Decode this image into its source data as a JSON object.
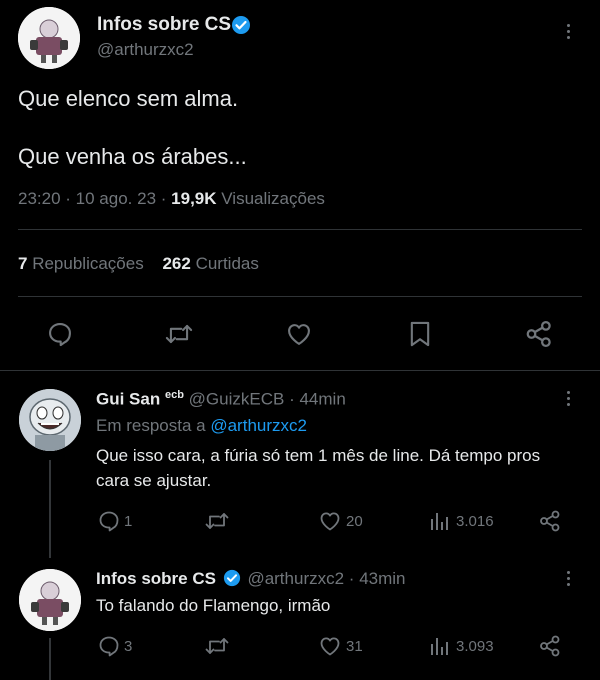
{
  "colors": {
    "background": "#000000",
    "text": "#e7e9ea",
    "muted": "#71767b",
    "accent": "#1d9bf0",
    "divider": "#2f3336"
  },
  "main_tweet": {
    "author_name": "Infos sobre CS",
    "handle": "@arthurzxc2",
    "text_line1": "Que elenco sem alma.",
    "text_line2": "Que venha os árabes...",
    "time": "23:20",
    "date": "10 ago. 23",
    "views_count": "19,9K",
    "views_label": "Visualizações",
    "reposts_count": "7",
    "reposts_label": "Republicações",
    "likes_count": "262",
    "likes_label": "Curtidas",
    "icons": [
      "reply-icon",
      "retweet-icon",
      "like-icon",
      "bookmark-icon",
      "share-icon"
    ]
  },
  "replies": [
    {
      "author_name": "Gui San",
      "author_superscript": "ecb",
      "handle": "@GuizkECB",
      "time_ago": "44min",
      "reply_to_prefix": "Em resposta a",
      "reply_to_handle": "@arthurzxc2",
      "text_line1": "Que isso cara, a fúria só tem 1 mês de line. Dá tempo pros",
      "text_line2": "cara se ajustar.",
      "reply_count": "1",
      "like_count": "20",
      "view_count": "3.016"
    },
    {
      "author_name": "Infos sobre CS",
      "handle": "@arthurzxc2",
      "time_ago": "43min",
      "text_line1": "To falando do Flamengo, irmão",
      "reply_count": "3",
      "like_count": "31",
      "view_count": "3.093"
    }
  ]
}
